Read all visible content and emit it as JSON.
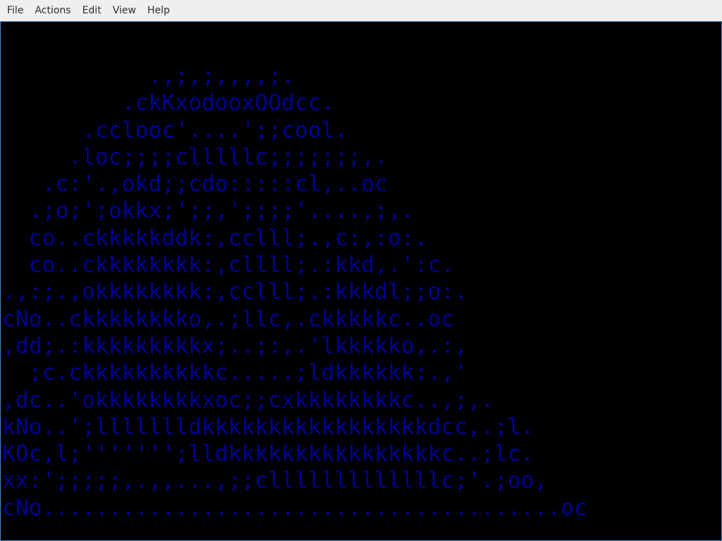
{
  "menubar": {
    "items": [
      {
        "label": "File"
      },
      {
        "label": "Actions"
      },
      {
        "label": "Edit"
      },
      {
        "label": "View"
      },
      {
        "label": "Help"
      }
    ]
  },
  "canvas": {
    "background_color": "#000000",
    "text_color": "#000096",
    "border_color": "#4a86c8",
    "lines": [
      "           .,;,;,,,,;.",
      "         .ckKxodooxOOdcc.",
      "      .cclooc'....';;cool.",
      "     .loc;;;;clllllc;;;;;;;,.",
      "   .c:'.,okd;;cdo:::::cl,..oc",
      "  .;o;';okkx;';;,';;;;'....,;,.",
      "  co..ckkkkkddk:,cclll;.,c:,:o:.",
      "  co..ckkkkkkkk:,cllll;.:kkd,.':c.",
      ".,:;.,okkkkkkkk:,cclll;.:kkkdl;;o:.",
      "cNo..ckkkkkkkko,.;llc,.ckkkkkc..oc",
      ",dd;.:kkkkkkkkkx;..;:,.'lkkkkko,.:,",
      "  ;c.ckkkkkkkkkkc.....;ldkkkkkk:.,'",
      ",dc..'okkkkkkkkxoc;;cxkkkkkkkkc..,;,.",
      "kNo..';llllllldkkkkkkkkkkkkkkkkkdcc,.;l.",
      "KOc,l;''''''';lldkkkkkkkkkkkkkkkkc..;lc.",
      "xx:';;;;;,.,,...,;;clllllllllllllc;'.;oo,",
      "cNo.......................................oc"
    ]
  }
}
